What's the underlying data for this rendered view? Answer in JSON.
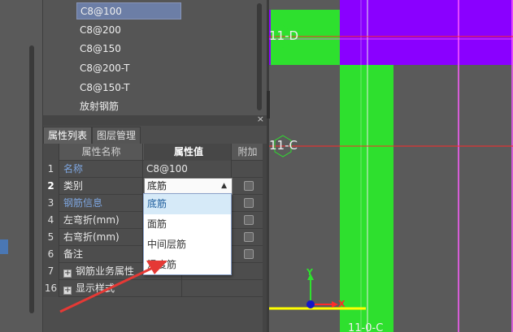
{
  "rebar_list": {
    "items": [
      {
        "label": "C8@100",
        "selected": true
      },
      {
        "label": "C8@200",
        "selected": false
      },
      {
        "label": "C8@150",
        "selected": false
      },
      {
        "label": "C8@200-T",
        "selected": false
      },
      {
        "label": "C8@150-T",
        "selected": false
      },
      {
        "label": "放射钢筋",
        "selected": false
      }
    ]
  },
  "property_panel": {
    "close_label": "×",
    "tabs": [
      {
        "label": "属性列表",
        "active": true
      },
      {
        "label": "图层管理",
        "active": false
      }
    ],
    "headers": {
      "name": "属性名称",
      "value": "属性值",
      "extra": "附加"
    },
    "rows": [
      {
        "num": "1",
        "name": "名称",
        "value": "C8@100"
      },
      {
        "num": "2",
        "name": "类别",
        "value": "底筋"
      },
      {
        "num": "3",
        "name": "钢筋信息",
        "value": ""
      },
      {
        "num": "4",
        "name": "左弯折(mm)",
        "value": ""
      },
      {
        "num": "5",
        "name": "右弯折(mm)",
        "value": ""
      },
      {
        "num": "6",
        "name": "备注",
        "value": ""
      },
      {
        "num": "7",
        "name": "钢筋业务属性",
        "value": ""
      },
      {
        "num": "16",
        "name": "显示样式",
        "value": ""
      }
    ],
    "expand_icon": "+"
  },
  "category_dropdown": {
    "options": [
      {
        "label": "底筋",
        "highlighted": true
      },
      {
        "label": "面筋",
        "highlighted": false
      },
      {
        "label": "中间层筋",
        "highlighted": false
      },
      {
        "label": "温度筋",
        "highlighted": false
      }
    ]
  },
  "cad_view": {
    "axis_labels": [
      "11-D",
      "11-C"
    ],
    "bottom_label": "11-0-C",
    "ucs": {
      "x_label": "X",
      "y_label": "Y"
    }
  },
  "colors": {
    "rebar_green": "#2ee02e",
    "slab_purple": "#8a00ff",
    "axis_red": "#ff2a2a",
    "magenta_line": "#ff5cff",
    "annotation_red": "#e53935",
    "highlight_blue": "#7ea6e0"
  }
}
